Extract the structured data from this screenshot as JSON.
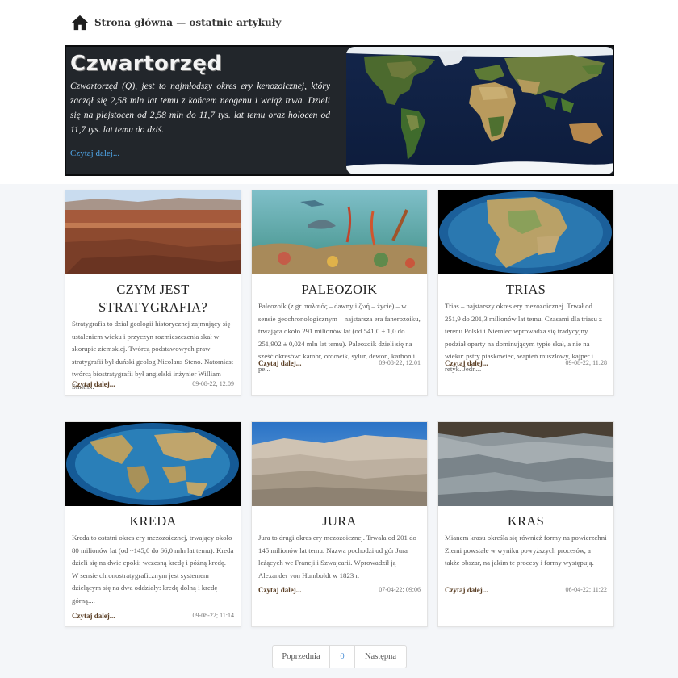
{
  "breadcrumb": {
    "icon": "home-icon",
    "text": "Strona główna — ostatnie artykuły"
  },
  "hero": {
    "title": "Czwartorzęd",
    "text": "Czwartorzęd (Q), jest to najmłodszy okres ery kenozoicznej, który zaczął się 2,58 mln lat temu z końcem neogenu i wciąż trwa. Dzieli się na plejstocen od 2,58 mln do 11,7 tys. lat temu oraz holocen od 11,7 tys. lat temu do dziś.",
    "more": "Czytaj dalej..."
  },
  "cards": [
    {
      "title": "CZYM JEST STRATYGRAFIA?",
      "text": "Stratygrafia to dział geologii historycznej zajmujący się ustaleniem wieku i przyczyn rozmieszczenia skał w skorupie ziemskiej. Twórcą podstawowych praw stratygrafii był duński geolog Nicolaus Steno. Natomiast twórcą biostratygrafii był angielski inżynier William Smith...",
      "link": "Czytaj dalej...",
      "date": "09-08-22; 12:09"
    },
    {
      "title": "PALEOZOIK",
      "text": "Paleozoik (z gr. παλαιός – dawny i ζωή – życie) – w sensie geochronologicznym – najstarsza era fanerozoiku, trwająca około 291 milionów lat (od 541,0 ± 1,0 do 251,902 ± 0,024 mln lat temu). Paleozoik dzieli się na sześć okresów: kambr, ordowik, sylur, dewon, karbon i pe...",
      "link": "Czytaj dalej...",
      "date": "09-08-22; 12:01"
    },
    {
      "title": "TRIAS",
      "text": "Trias – najstarszy okres ery mezozoicznej. Trwał od 251,9 do 201,3 milionów lat temu. Czasami dla triasu z terenu Polski i Niemiec wprowadza się tradycyjny podział oparty na dominującym typie skał, a nie na wieku: pstry piaskowiec, wapień muszlowy, kajper i retyk. Jedn...",
      "link": "Czytaj dalej...",
      "date": "09-08-22; 11:28"
    },
    {
      "title": "KREDA",
      "text": "Kreda to ostatni okres ery mezozoicznej, trwający około 80 milionów lat (od ~145,0 do 66,0 mln lat temu). Kreda dzieli się na dwie epoki: wczesną kredę i późną kredę. W sensie chronostratygraficznym jest systemem dzielącym się na dwa oddziały: kredę dolną i kredę górną....",
      "link": "Czytaj dalej...",
      "date": "09-08-22; 11:14"
    },
    {
      "title": "JURA",
      "text": "Jura to drugi okres ery mezozoicznej. Trwała od 201 do 145 milionów lat temu. Nazwa pochodzi od gór Jura leżących we Francji i Szwajcarii. Wprowadził ją Alexander von Humboldt w 1823 r.",
      "link": "Czytaj dalej...",
      "date": "07-04-22; 09:06"
    },
    {
      "title": "KRAS",
      "text": "Mianem krasu określa się również formy na powierzchni Ziemi powstałe w wyniku powyższych procesów, a także obszar, na jakim te procesy i formy występują.",
      "link": "Czytaj dalej...",
      "date": "06-04-22; 11:22"
    }
  ],
  "pagination": {
    "prev": "Poprzednia",
    "current": "0",
    "next": "Następna"
  }
}
